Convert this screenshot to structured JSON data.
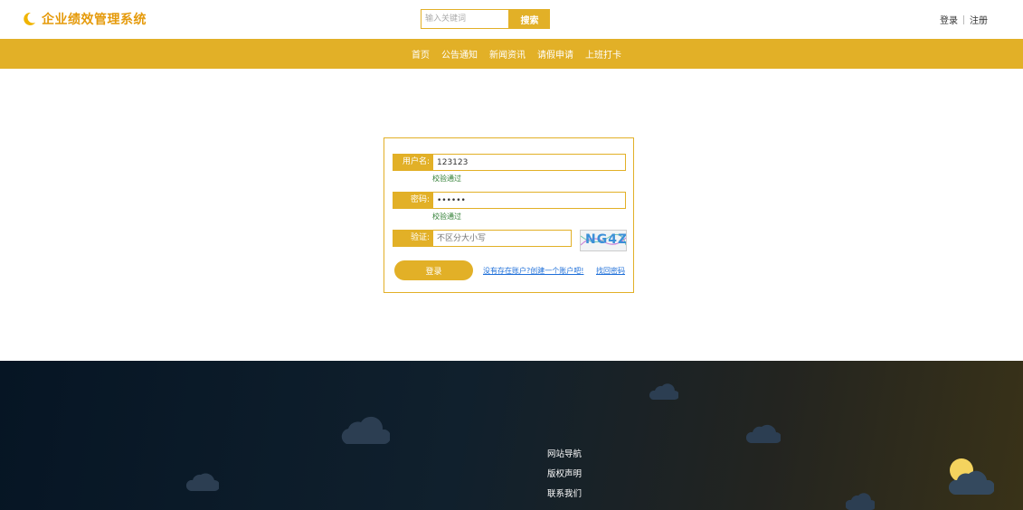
{
  "header": {
    "site_title": "企业绩效管理系统",
    "search": {
      "placeholder": "输入关键词",
      "button_label": "搜索"
    },
    "auth": {
      "login_label": "登录",
      "register_label": "注册"
    }
  },
  "nav": {
    "items": [
      {
        "label": "首页"
      },
      {
        "label": "公告通知"
      },
      {
        "label": "新闻资讯"
      },
      {
        "label": "请假申请"
      },
      {
        "label": "上班打卡"
      }
    ]
  },
  "login_form": {
    "username": {
      "label": "用户名:",
      "value": "123123",
      "validation": "校验通过"
    },
    "password": {
      "label": "密码:",
      "value": "••••••",
      "validation": "校验通过"
    },
    "captcha": {
      "label": "验证:",
      "placeholder": "不区分大小写",
      "image_text": "NG4Z"
    },
    "submit_label": "登录",
    "register_link": "没有存在账户?创建一个账户吧!",
    "forgot_link": "找回密码"
  },
  "footer": {
    "links": [
      {
        "label": "网站导航"
      },
      {
        "label": "版权声明"
      },
      {
        "label": "联系我们"
      }
    ]
  },
  "colors": {
    "accent": "#e2b027",
    "brand_text": "#e59a0b",
    "footer_dark": "#061524",
    "success": "#2e7d32",
    "link": "#1e6fd9"
  }
}
